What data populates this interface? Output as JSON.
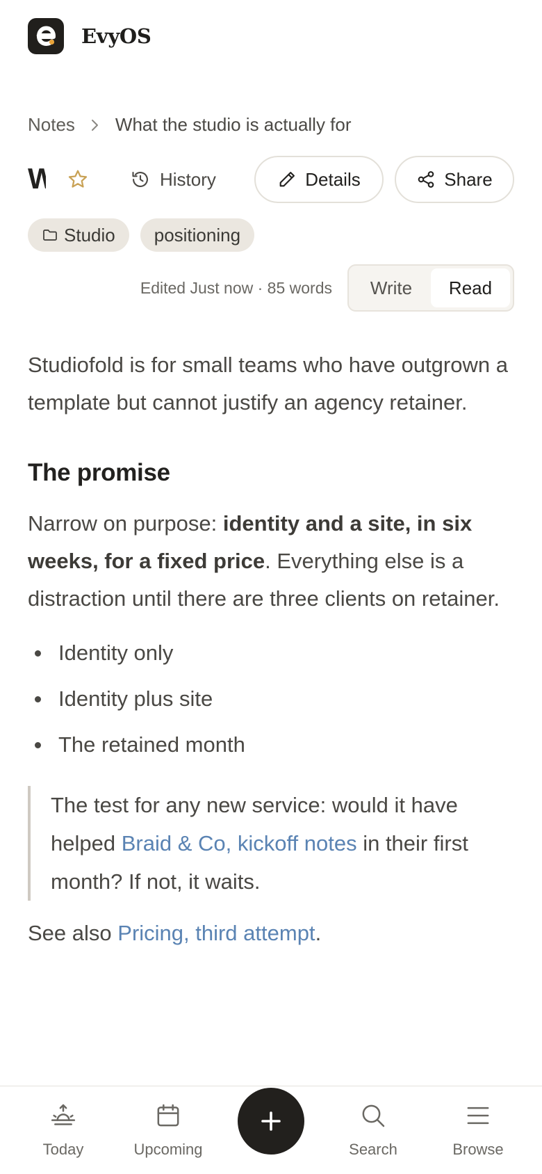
{
  "app": {
    "name": "EvyOS"
  },
  "breadcrumb": {
    "root": "Notes",
    "current": "What the studio is actually for"
  },
  "note": {
    "title": "What the studio is actually for",
    "tags": [
      "Studio",
      "positioning"
    ],
    "meta": "Edited Just now · 85 words"
  },
  "toolbar": {
    "history_label": "History",
    "details_label": "Details",
    "share_label": "Share"
  },
  "mode": {
    "write_label": "Write",
    "read_label": "Read",
    "selected": "Read"
  },
  "body": {
    "intro": "Studiofold is for small teams who have outgrown a template but cannot justify an agency retainer.",
    "heading": "The promise",
    "p_start": "Narrow on purpose: ",
    "p_bold": "identity and a site, in six weeks, for a fixed price",
    "p_end": ". Everything else is a distraction until there are three clients on retainer.",
    "bullets": [
      "Identity only",
      "Identity plus site",
      "The retained month"
    ],
    "quote_start": "The test for any new service: would it have helped ",
    "quote_link": "Braid & Co, kickoff notes",
    "quote_end": " in their first month? If not, it waits.",
    "see_also_prefix": "See also ",
    "see_also_link": "Pricing, third attempt",
    "see_also_suffix": "."
  },
  "nav": {
    "today": "Today",
    "upcoming": "Upcoming",
    "search": "Search",
    "browse": "Browse"
  },
  "colors": {
    "accent_link": "#5a83b3",
    "star": "#c9a256",
    "logo_dot": "#e8a33a",
    "dark": "#22201d"
  },
  "icons": [
    "app-logo",
    "chevron-right-icon",
    "star-icon",
    "history-icon",
    "pencil-icon",
    "share-icon",
    "folder-icon",
    "sunrise-icon",
    "calendar-icon",
    "plus-icon",
    "search-icon",
    "menu-icon"
  ]
}
